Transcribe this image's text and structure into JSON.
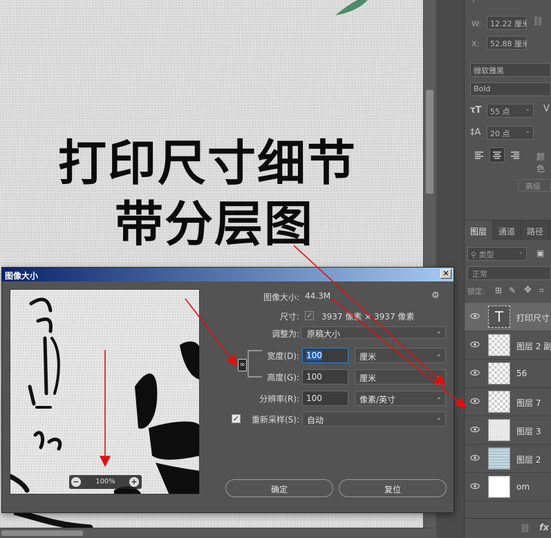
{
  "canvas": {
    "title_line1": "打印尺寸细节",
    "title_line2": "带分层图"
  },
  "properties": {
    "w_label": "W:",
    "w_value": "12.22 厘米",
    "x_label": "X:",
    "x_value": "52.88 厘米",
    "font_family": "微软雅黑",
    "font_style": "Bold",
    "font_size": "55 点",
    "leading": "20 点",
    "color_label": "颜色",
    "advanced_label": "高级"
  },
  "layers": {
    "tabs": [
      "图层",
      "通道",
      "路径"
    ],
    "filter_label": "类型",
    "blend_mode": "正常",
    "lock_label": "锁定:",
    "items": [
      {
        "name": "打印尺寸",
        "type": "text"
      },
      {
        "name": "图层 2 副",
        "type": "checker"
      },
      {
        "name": "56",
        "type": "checker"
      },
      {
        "name": "图层 7",
        "type": "checker"
      },
      {
        "name": "图层 3",
        "type": "texture"
      },
      {
        "name": "图层 2",
        "type": "blue"
      },
      {
        "name": "om",
        "type": "white"
      }
    ],
    "footer_fx": "fx"
  },
  "dialog": {
    "title": "图像大小",
    "close": "✕",
    "image_size_label": "图像大小:",
    "image_size_value": "44.3M",
    "dimensions_label": "尺寸:",
    "dimensions_value": "3937 像素 × 3937 像素",
    "fit_to_label": "调整为:",
    "fit_to_value": "原稿大小",
    "width_label": "宽度(D):",
    "width_value": "100",
    "width_unit": "厘米",
    "height_label": "高度(G):",
    "height_value": "100",
    "height_unit": "厘米",
    "resolution_label": "分辨率(R):",
    "resolution_value": "100",
    "resolution_unit": "像素/英寸",
    "resample_label": "重新采样(S):",
    "resample_value": "自动",
    "ok_button": "确定",
    "reset_button": "复位",
    "zoom_value": "100%"
  }
}
